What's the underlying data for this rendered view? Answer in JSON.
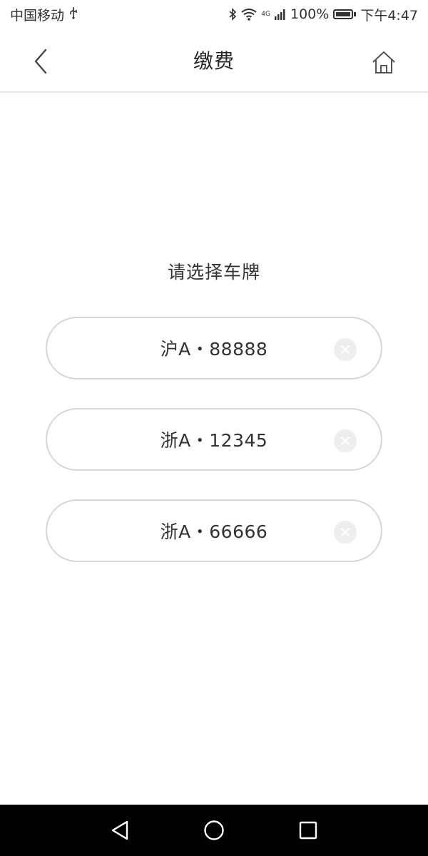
{
  "status_bar": {
    "carrier": "中国移动",
    "network": "4G",
    "battery": "100%",
    "time": "下午4:47"
  },
  "nav": {
    "title": "缴费"
  },
  "prompt": "请选择车牌",
  "plates": [
    {
      "label": "沪A・88888"
    },
    {
      "label": "浙A・12345"
    },
    {
      "label": "浙A・66666"
    }
  ],
  "icons": {
    "back": "chevron-left-icon",
    "home": "home-icon",
    "delete": "close-icon",
    "android_back": "triangle-back-icon",
    "android_home": "circle-home-icon",
    "android_recent": "square-recent-icon"
  },
  "colors": {
    "border": "#d7d7d7",
    "divider": "#e8e8e8",
    "text": "#333333",
    "system_nav": "#000000"
  }
}
